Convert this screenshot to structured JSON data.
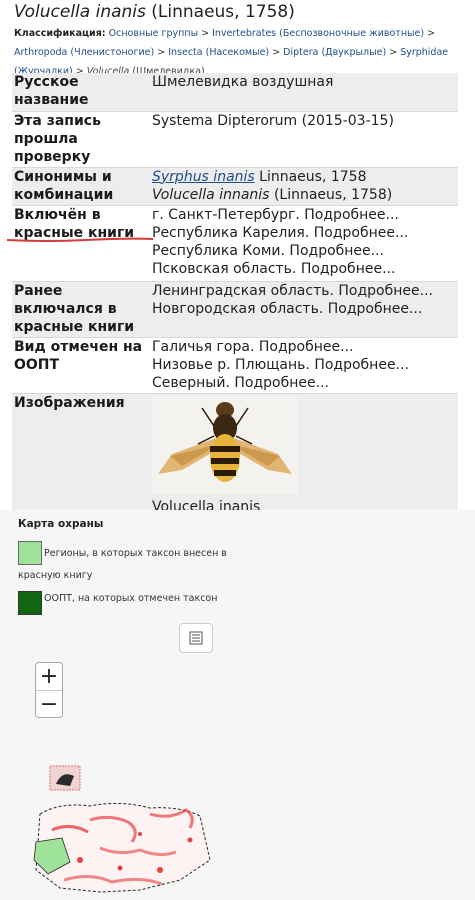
{
  "title": {
    "genus_species": "Volucella inanis",
    "author": "(Linnaeus, 1758)"
  },
  "classification": {
    "label": "Классификация:",
    "items": [
      "Основные группы",
      "Invertebrates (Беспозвоночные животные)",
      "Arthropoda (Членистоногие)",
      "Insecta (Насекомые)",
      "Diptera (Двукрылые)",
      "Syrphidae (Журчалки)",
      "Volucella"
    ],
    "last_suffix": "(Шмелевидка)",
    "separator": ">"
  },
  "rows": [
    {
      "label": "Русское название",
      "value": "Шмелевидка воздушная"
    },
    {
      "label": "Эта запись прошла проверку",
      "value": "Systema Dipterorum (2015-03-15)"
    },
    {
      "label": "Синонимы и комбинации",
      "synonyms": [
        {
          "name": "Syrphus inanis",
          "author": "Linnaeus, 1758",
          "link": true
        },
        {
          "name": "Volucella innanis",
          "author": "(Linnaeus, 1758)",
          "link": false
        }
      ]
    },
    {
      "label": "Включён в красные книги",
      "values": [
        "г. Санкт-Петербург. Подробнее...",
        "Республика Карелия. Подробнее...",
        "Республика Коми. Подробнее...",
        "Псковская область. Подробнее..."
      ]
    },
    {
      "label": "Ранее включался в красные книги",
      "values": [
        "Ленинградская область. Подробнее...",
        "Новгородская область. Подробнее..."
      ]
    },
    {
      "label": "Вид отмечен на ООПТ",
      "values": [
        "Галичья гора. Подробнее...",
        "Низовье р. Плющань. Подробнее...",
        "Северный. Подробнее..."
      ]
    },
    {
      "label": "Изображения",
      "caption": "Volucella inanis"
    }
  ],
  "map": {
    "title": "Карта охраны",
    "legend_regions": "Регионы, в которых таксон внесен в красную книгу",
    "legend_oopt": "ООПТ, на которых отмечен таксон",
    "zoom_in": "+",
    "zoom_out": "−",
    "colors": {
      "regions": "#9fe39a",
      "oopt": "#116611",
      "marks": "#e84040"
    }
  },
  "icons": {
    "layers": "layers-list-icon",
    "specimen": "hoverfly-photo"
  }
}
